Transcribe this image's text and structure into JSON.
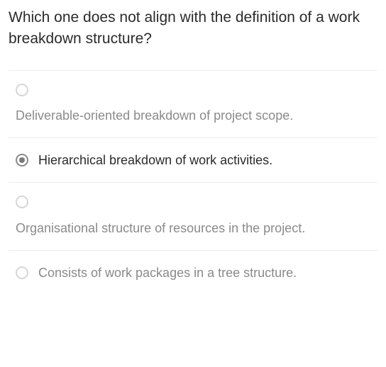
{
  "question": "Which one does not align with the definition of a work breakdown structure?",
  "options": [
    {
      "label": "Deliverable-oriented breakdown of project scope.",
      "selected": false,
      "layout": "stacked",
      "muted": true
    },
    {
      "label": "Hierarchical breakdown of work activities.",
      "selected": true,
      "layout": "inline",
      "muted": false
    },
    {
      "label": "Organisational structure of resources in the project.",
      "selected": false,
      "layout": "stacked",
      "muted": true
    },
    {
      "label": "Consists of work packages in a tree structure.",
      "selected": false,
      "layout": "inline",
      "muted": true
    }
  ]
}
